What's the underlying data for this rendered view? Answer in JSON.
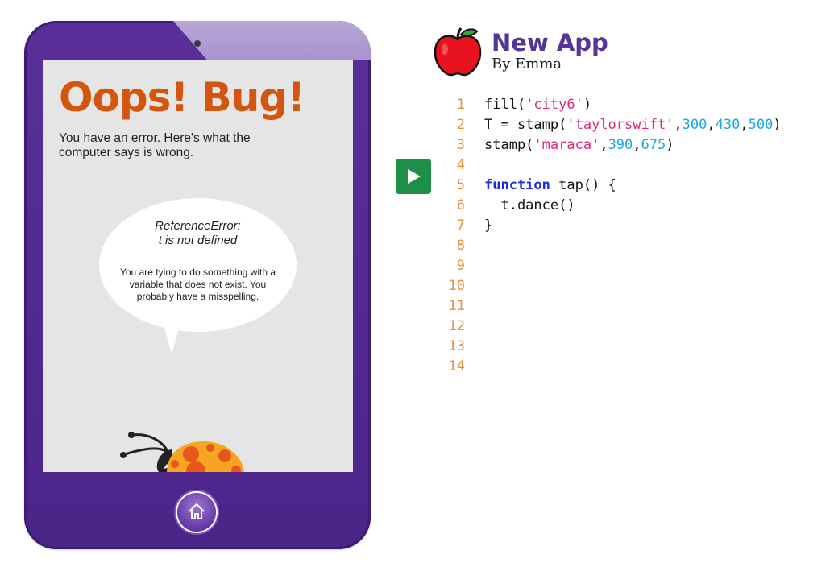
{
  "app": {
    "title": "New App",
    "author": "By Emma",
    "icon": "apple-icon"
  },
  "device": {
    "error_screen": {
      "heading": "Oops! Bug!",
      "message": "You have an error. Here's what the computer says is wrong.",
      "error_type": "ReferenceError:",
      "error_message": "t is not defined",
      "explanation": "You are tying to do something with a variable that does not exist. You probably have a misspelling."
    },
    "home_button_icon": "home-icon",
    "mascot": "ladybug"
  },
  "editor": {
    "run_button_icon": "play-icon",
    "lines": [
      {
        "number": "1",
        "tokens": [
          {
            "t": "fill(",
            "c": "plain"
          },
          {
            "t": "'city6'",
            "c": "str"
          },
          {
            "t": ")",
            "c": "plain"
          }
        ]
      },
      {
        "number": "2",
        "tokens": [
          {
            "t": "T = stamp(",
            "c": "plain"
          },
          {
            "t": "'taylorswift'",
            "c": "str"
          },
          {
            "t": ",",
            "c": "plain"
          },
          {
            "t": "300",
            "c": "num"
          },
          {
            "t": ",",
            "c": "plain"
          },
          {
            "t": "430",
            "c": "num"
          },
          {
            "t": ",",
            "c": "plain"
          },
          {
            "t": "500",
            "c": "num"
          },
          {
            "t": ")",
            "c": "plain"
          }
        ]
      },
      {
        "number": "3",
        "tokens": [
          {
            "t": "stamp(",
            "c": "plain"
          },
          {
            "t": "'maraca'",
            "c": "str"
          },
          {
            "t": ",",
            "c": "plain"
          },
          {
            "t": "390",
            "c": "num"
          },
          {
            "t": ",",
            "c": "plain"
          },
          {
            "t": "675",
            "c": "num"
          },
          {
            "t": ")",
            "c": "plain"
          }
        ]
      },
      {
        "number": "4",
        "tokens": []
      },
      {
        "number": "5",
        "tokens": [
          {
            "t": "function",
            "c": "kw"
          },
          {
            "t": " tap() {",
            "c": "plain"
          }
        ]
      },
      {
        "number": "6",
        "tokens": [
          {
            "t": "  t.dance()",
            "c": "plain"
          }
        ]
      },
      {
        "number": "7",
        "tokens": [
          {
            "t": "}",
            "c": "plain"
          }
        ]
      },
      {
        "number": "8",
        "tokens": []
      },
      {
        "number": "9",
        "tokens": []
      },
      {
        "number": "10",
        "tokens": []
      },
      {
        "number": "11",
        "tokens": []
      },
      {
        "number": "12",
        "tokens": []
      },
      {
        "number": "13",
        "tokens": []
      },
      {
        "number": "14",
        "tokens": []
      }
    ]
  },
  "colors": {
    "device_purple": "#4a2588",
    "heading_orange": "#d4560e",
    "title_purple": "#55359c",
    "run_green": "#1c9048",
    "line_number_orange": "#e8913b",
    "string_pink": "#e0287a",
    "number_blue": "#1ea6dc",
    "keyword_blue": "#1a2ee0"
  }
}
